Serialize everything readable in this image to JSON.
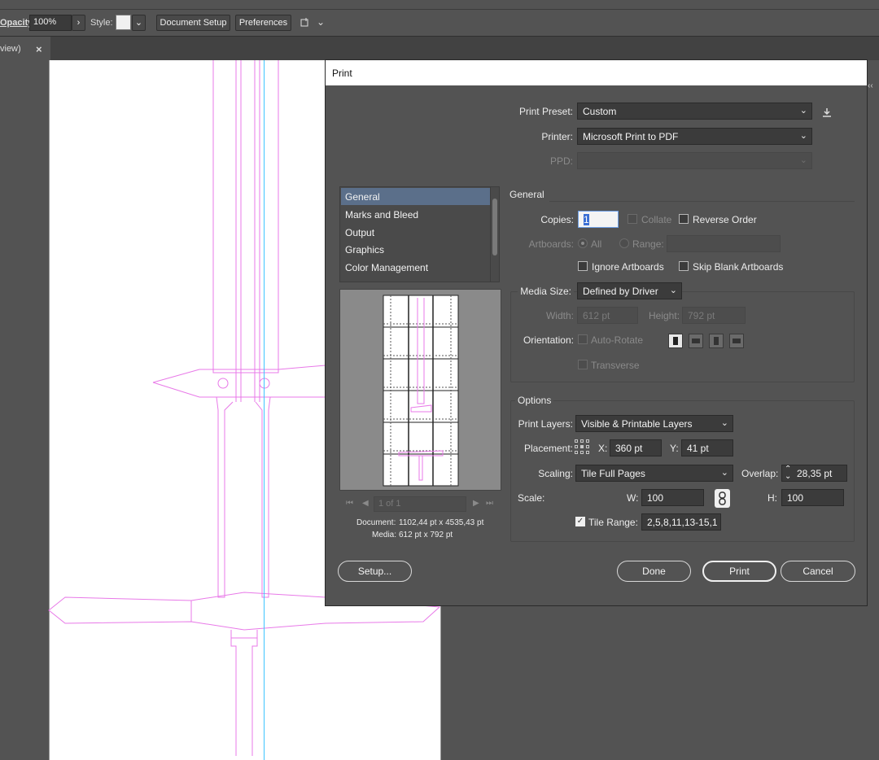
{
  "control_bar": {
    "opacity_label": "Opacity:",
    "opacity_value": "100%",
    "style_label": "Style:",
    "document_setup": "Document Setup",
    "preferences": "Preferences"
  },
  "tab": {
    "label": "view)",
    "close": "×"
  },
  "dialog": {
    "title": "Print",
    "print_preset_label": "Print Preset:",
    "print_preset_value": "Custom",
    "printer_label": "Printer:",
    "printer_value": "Microsoft Print to PDF",
    "ppd_label": "PPD:",
    "categories": [
      {
        "label": "General"
      },
      {
        "label": "Marks and Bleed"
      },
      {
        "label": "Output"
      },
      {
        "label": "Graphics"
      },
      {
        "label": "Color Management"
      }
    ],
    "general_heading": "General",
    "copies_label": "Copies:",
    "copies_value": "1",
    "collate_label": "Collate",
    "reverse_order_label": "Reverse Order",
    "artboards_label": "Artboards:",
    "all_label": "All",
    "range_label": "Range:",
    "ignore_artboards_label": "Ignore Artboards",
    "skip_blank_label": "Skip Blank Artboards",
    "media_size_label": "Media Size:",
    "media_size_value": "Defined by Driver",
    "width_label": "Width:",
    "width_value": "612 pt",
    "height_label": "Height:",
    "height_value": "792 pt",
    "orientation_label": "Orientation:",
    "auto_rotate_label": "Auto-Rotate",
    "transverse_label": "Transverse",
    "options_heading": "Options",
    "print_layers_label": "Print Layers:",
    "print_layers_value": "Visible & Printable Layers",
    "placement_label": "Placement:",
    "x_label": "X:",
    "x_value": "360 pt",
    "y_label": "Y:",
    "y_value": "41 pt",
    "scaling_label": "Scaling:",
    "scaling_value": "Tile Full Pages",
    "overlap_label": "Overlap:",
    "overlap_value": "28,35 pt",
    "scale_label": "Scale:",
    "w_label": "W:",
    "w_value": "100",
    "h_label": "H:",
    "h_value": "100",
    "tile_range_label": "Tile Range:",
    "tile_range_value": "2,5,8,11,13-15,1",
    "page_indicator": "1 of 1",
    "document_label": "Document:",
    "document_value": "1102,44 pt x 4535,43 pt",
    "media_label": "Media:",
    "media_value": "612 pt x 792 pt",
    "setup_button": "Setup...",
    "done_button": "Done",
    "print_button": "Print",
    "cancel_button": "Cancel"
  },
  "colors": {
    "artwork_outline": "#e879e8",
    "guide": "#3ec5ff",
    "selected_category": "#5b6f8a"
  }
}
